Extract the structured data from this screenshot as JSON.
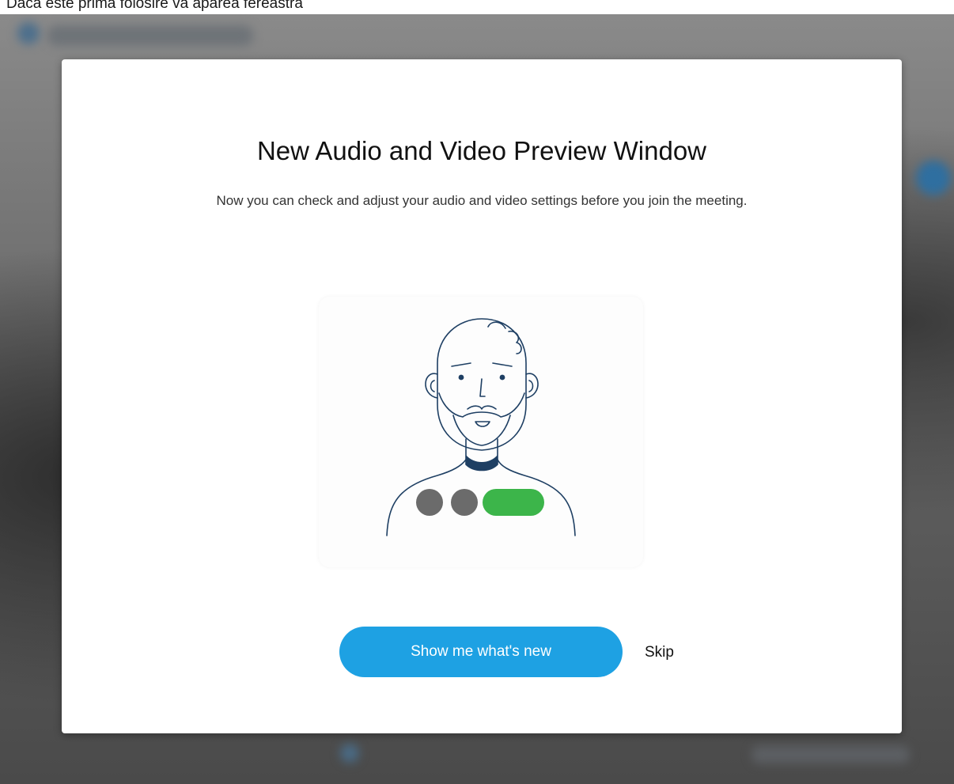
{
  "caption": "Daca este prima folosire va aparea fereastra",
  "dialog": {
    "title": "New Audio and Video Preview Window",
    "description": "Now you can check and adjust your audio and video settings before you join the meeting.",
    "illustration": {
      "icon": "person-preview-illustration",
      "controls": [
        "mic-toggle-icon",
        "camera-toggle-icon",
        "join-pill-icon"
      ]
    },
    "primary_button_label": "Show me what's new",
    "skip_label": "Skip"
  },
  "colors": {
    "accent": "#1ea1e3",
    "join_green": "#3cb54a",
    "control_gray": "#6b6b6b",
    "line_blue": "#1e3f63"
  }
}
